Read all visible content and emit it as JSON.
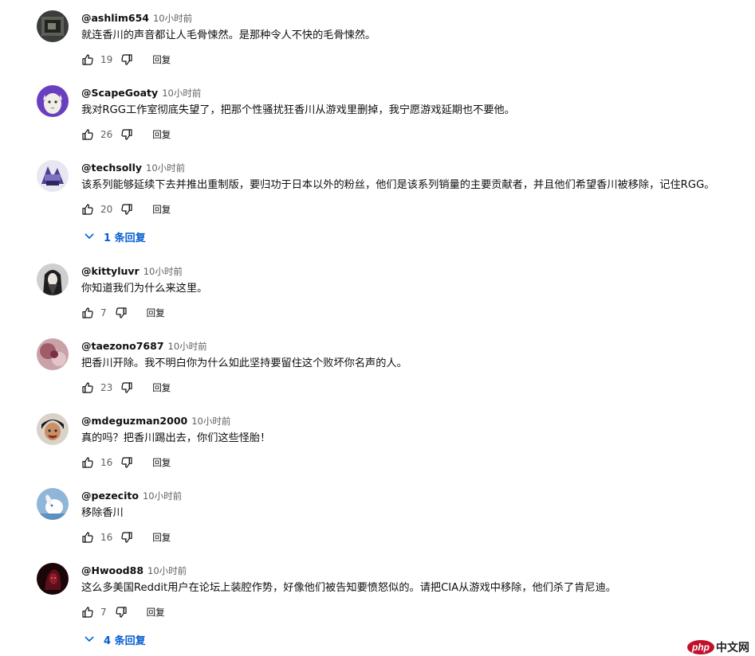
{
  "labels": {
    "reply": "回复"
  },
  "colors": {
    "link_blue": "#065fd4",
    "secondary_text": "#606060"
  },
  "comments": [
    {
      "author": "@ashlim654",
      "time": "10小时前",
      "text": "就连香川的声音都让人毛骨悚然。是那种令人不快的毛骨悚然。",
      "likes": "19",
      "avatar_icon": "dark-photo-avatar"
    },
    {
      "author": "@ScapeGoaty",
      "time": "10小时前",
      "text": "我对RGG工作室彻底失望了，把那个性骚扰狂香川从游戏里删掉，我宁愿游戏延期也不要他。",
      "likes": "26",
      "avatar_icon": "goat-avatar"
    },
    {
      "author": "@techsolly",
      "time": "10小时前",
      "text": "该系列能够延续下去并推出重制版，要归功于日本以外的粉丝，他们是该系列销量的主要贡献者，并且他们希望香川被移除，记住RGG。",
      "likes": "20",
      "replies": "1 条回复",
      "avatar_icon": "logo-avatar"
    },
    {
      "author": "@kittyluvr",
      "time": "10小时前",
      "text": "你知道我们为什么来这里。",
      "likes": "7",
      "avatar_icon": "portrait-avatar"
    },
    {
      "author": "@taezono7687",
      "time": "10小时前",
      "text": "把香川开除。我不明白你为什么如此坚持要留住这个败坏你名声的人。",
      "likes": "23",
      "avatar_icon": "pink-photo-avatar"
    },
    {
      "author": "@mdeguzman2000",
      "time": "10小时前",
      "text": "真的吗？把香川踢出去，你们这些怪胎！",
      "likes": "16",
      "avatar_icon": "face-avatar"
    },
    {
      "author": "@pezecito",
      "time": "10小时前",
      "text": "移除香川",
      "likes": "16",
      "avatar_icon": "white-creature-avatar"
    },
    {
      "author": "@Hwood88",
      "time": "10小时前",
      "text": "这么多美国Reddit用户在论坛上装腔作势，好像他们被告知要愤怒似的。请把CIA从游戏中移除，他们杀了肯尼迪。",
      "likes": "7",
      "replies": "4 条回复",
      "avatar_icon": "dark-red-avatar"
    }
  ]
}
